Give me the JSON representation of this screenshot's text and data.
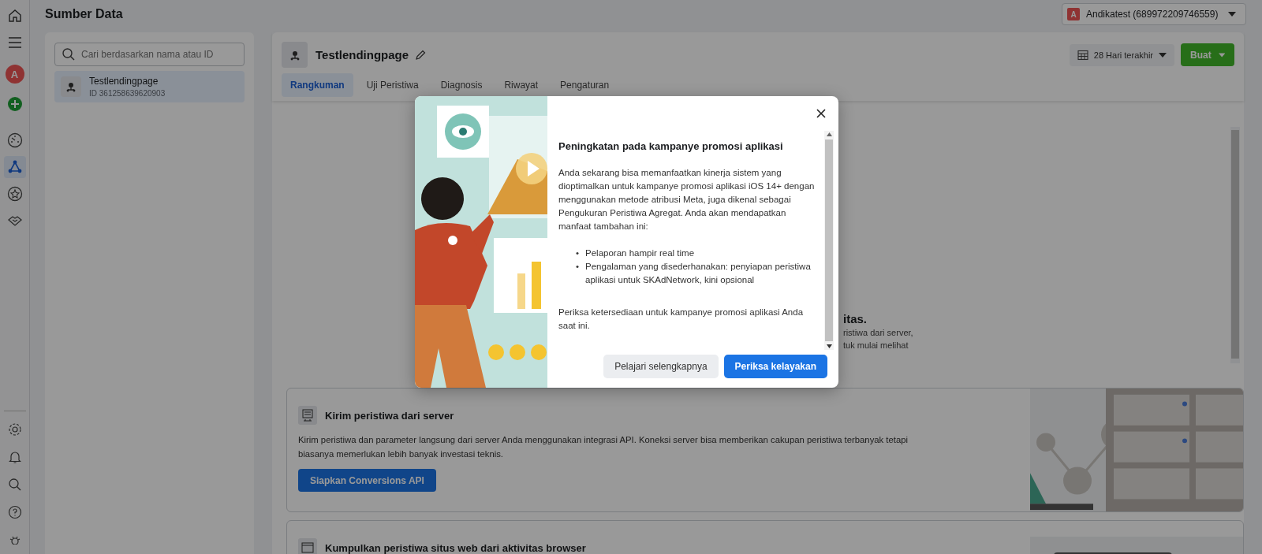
{
  "header": {
    "title": "Sumber Data",
    "account": {
      "initial": "A",
      "name": "Andikatest (689972209746559)"
    }
  },
  "rail": {
    "avatar": "A",
    "top": [
      {
        "kind": "home",
        "selected": false
      },
      {
        "kind": "menu",
        "selected": false
      }
    ],
    "tools": [
      {
        "kind": "gauge",
        "selected": false
      },
      {
        "kind": "network",
        "selected": true
      },
      {
        "kind": "star",
        "selected": false
      },
      {
        "kind": "handshake",
        "selected": false
      }
    ],
    "bottom": [
      {
        "kind": "gear"
      },
      {
        "kind": "bell"
      },
      {
        "kind": "search"
      },
      {
        "kind": "help"
      },
      {
        "kind": "bug"
      }
    ]
  },
  "sources": {
    "search_placeholder": "Cari berdasarkan nama atau ID",
    "items": [
      {
        "name": "Testlendingpage",
        "id": "ID 361258639620903",
        "selected": true
      }
    ]
  },
  "main": {
    "title": "Testlendingpage",
    "date_range": "28 Hari terakhir",
    "create_button": "Buat",
    "tabs": [
      {
        "label": "Rangkuman",
        "selected": true
      },
      {
        "label": "Uji Peristiwa",
        "selected": false
      },
      {
        "label": "Diagnosis",
        "selected": false
      },
      {
        "label": "Riwayat",
        "selected": false
      },
      {
        "label": "Pengaturan",
        "selected": false
      }
    ]
  },
  "behind_modal": {
    "heading": "itas.",
    "lines": [
      "ristiwa dari server,",
      "tuk mulai melihat"
    ]
  },
  "cards": [
    {
      "kind": "server",
      "title": "Kirim peristiwa dari server",
      "description": "Kirim peristiwa dan parameter langsung dari server Anda menggunakan integrasi API. Koneksi server bisa memberikan cakupan peristiwa terbanyak tetapi biasanya memerlukan lebih banyak investasi teknis.",
      "button": "Siapkan Conversions API"
    },
    {
      "kind": "browser",
      "title": "Kumpulkan peristiwa situs web dari aktivitas browser"
    }
  ],
  "modal": {
    "title": "Peningkatan pada kampanye promosi aplikasi",
    "intro": "Anda sekarang bisa memanfaatkan kinerja sistem yang dioptimalkan untuk kampanye promosi aplikasi iOS 14+ dengan menggunakan metode atribusi Meta, juga dikenal sebagai Pengukuran Peristiwa Agregat. Anda akan mendapatkan manfaat tambahan ini:",
    "bullet_marker": "•",
    "bullets": [
      "Pelaporan hampir real time",
      "Pengalaman yang disederhanakan: penyiapan peristiwa aplikasi untuk SKAdNetwork, kini opsional"
    ],
    "closing": "Periksa ketersediaan untuk kampanye promosi aplikasi Anda saat ini.",
    "secondary_button": "Pelajari selengkapnya",
    "primary_button": "Periksa kelayakan"
  }
}
